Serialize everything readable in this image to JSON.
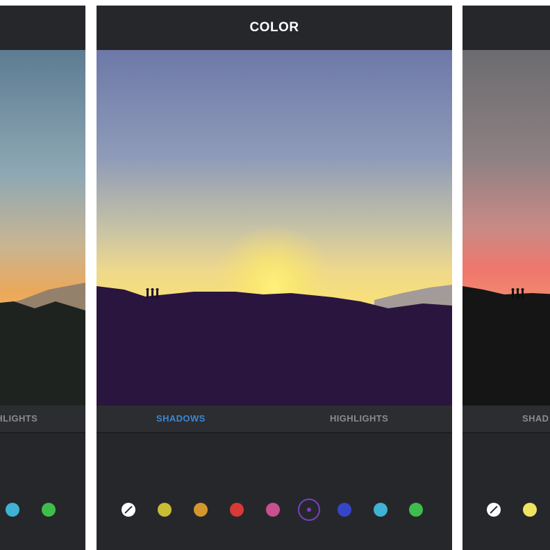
{
  "center": {
    "title": "COLOR",
    "tabs": [
      {
        "label": "SHADOWS",
        "active": true
      },
      {
        "label": "HIGHLIGHTS",
        "active": false
      }
    ],
    "swatches": [
      {
        "name": "none",
        "color": "#ffffff"
      },
      {
        "name": "yellow",
        "color": "#c8bd34"
      },
      {
        "name": "orange",
        "color": "#d4962d"
      },
      {
        "name": "red",
        "color": "#d83a36"
      },
      {
        "name": "pink",
        "color": "#c8508f"
      },
      {
        "name": "purple",
        "color": "#7a3fc4",
        "selected": true
      },
      {
        "name": "blue",
        "color": "#3545c9"
      },
      {
        "name": "cyan",
        "color": "#3fb3d3"
      },
      {
        "name": "green",
        "color": "#3fbd4c"
      }
    ]
  },
  "left": {
    "tab_partial": "HIGHLIGHTS",
    "swatches_partial": [
      {
        "name": "cyan",
        "color": "#3fb3d3"
      },
      {
        "name": "green",
        "color": "#3fbd4c"
      }
    ]
  },
  "right": {
    "tab_partial": "SHAD",
    "swatches_partial": [
      {
        "name": "none",
        "color": "#ffffff"
      },
      {
        "name": "yellow",
        "color": "#f0e360"
      }
    ]
  }
}
